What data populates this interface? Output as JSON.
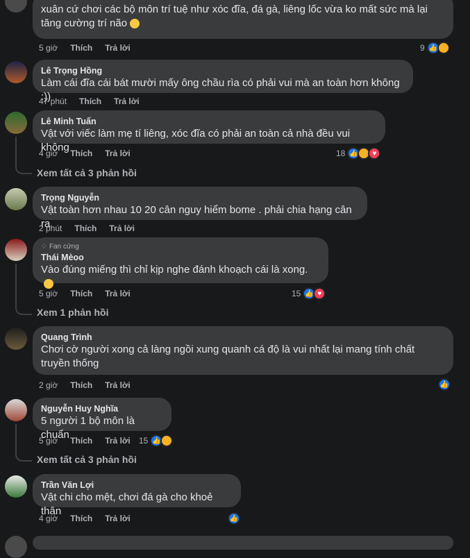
{
  "comments": [
    {
      "name": "",
      "text": "xuân cứ chơi các bộ môn trí tuệ như xóc đĩa, đá gà, liêng lốc vừa ko mất sức mà lại tăng cường trí não",
      "time": "5 giờ",
      "like": "Thích",
      "reply": "Trả lời",
      "reacts": "9"
    },
    {
      "name": "Lê Trọng Hồng",
      "text": "Làm cái đĩa cái bát mười mấy ông chầu rìa có phải vui mà an toàn hơn không :))",
      "time": "47 phút",
      "like": "Thích",
      "reply": "Trả lời",
      "reacts": ""
    },
    {
      "name": "Lê Minh Tuấn",
      "text": "Vật với viếc làm mẹ tí liêng, xóc đĩa có phải an toàn cả nhà đều vui không",
      "time": "4 giờ",
      "like": "Thích",
      "reply": "Trả lời",
      "reacts": "18",
      "more": "Xem tất cả 3 phản hồi"
    },
    {
      "name": "Trọng Nguyễn",
      "text": "Vật toàn hơn nhau 10 20 cân nguy hiểm bome . phải chia hạng cân ra",
      "time": "2 phút",
      "like": "Thích",
      "reply": "Trả lời",
      "reacts": ""
    },
    {
      "badge": "Fan cứng",
      "name": "Thái Mèoo",
      "text": "Vào đúng miếng thì chỉ kịp nghe đánh khoạch cái là xong.",
      "time": "5 giờ",
      "like": "Thích",
      "reply": "Trả lời",
      "reacts": "15",
      "more": "Xem 1 phản hồi"
    },
    {
      "name": "Quang Trình",
      "text": "Chơi cờ người xong cả làng ngồi xung quanh cá độ là vui nhất lại mang tính chất truyền thống",
      "time": "2 giờ",
      "like": "Thích",
      "reply": "Trả lời",
      "reacts": ""
    },
    {
      "name": "Nguyễn Huy Nghĩa",
      "text": "5 người 1 bộ môn là chuẩn",
      "time": "5 giờ",
      "like": "Thích",
      "reply": "Trả lời",
      "reacts": "15",
      "more": "Xem tất cả 3 phản hồi"
    },
    {
      "name": "Trần Văn Lợi",
      "text": "Vật chi cho mệt, chơi đá gà cho khoẻ thân",
      "time": "4 giờ",
      "like": "Thích",
      "reply": "Trả lời",
      "reacts": ""
    }
  ],
  "icons": {
    "like": "like-icon",
    "haha": "haha-icon",
    "love": "love-icon",
    "diamond": "diamond-icon"
  }
}
